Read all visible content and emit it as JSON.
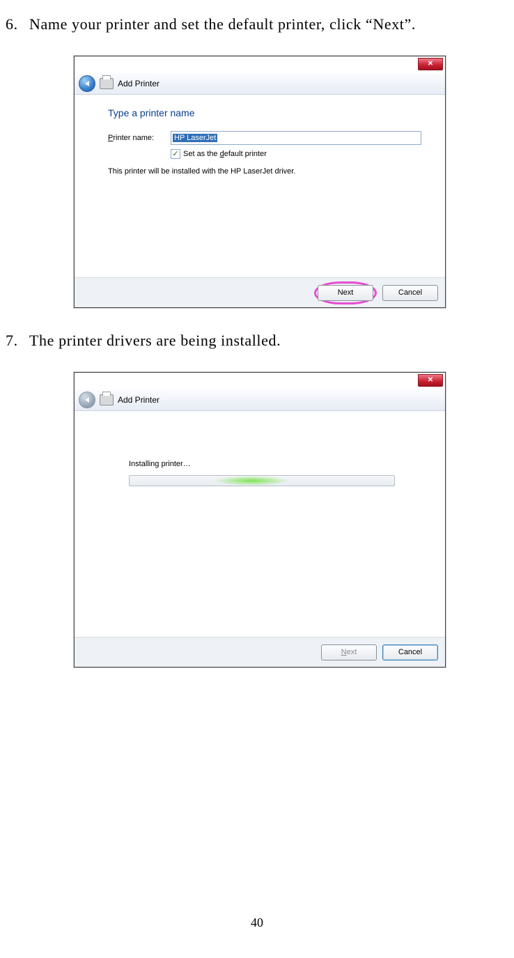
{
  "page_number": "40",
  "steps": {
    "s6": {
      "num": "6.",
      "text": "Name your printer and set the default printer, click “Next”."
    },
    "s7": {
      "num": "7.",
      "text": "The printer drivers are being installed."
    }
  },
  "dialog1": {
    "window_title": "Add Printer",
    "heading": "Type a printer name",
    "pname_label_pre": "P",
    "pname_label_mid": "rinter name:",
    "pname_value": "HP LaserJet",
    "default_pre": "Set as the ",
    "default_u": "d",
    "default_post": "efault printer",
    "driver_info": "This printer will be installed with the HP LaserJet driver.",
    "next": "Next",
    "cancel": "Cancel",
    "close": "✕"
  },
  "dialog2": {
    "window_title": "Add Printer",
    "installing": "Installing printer…",
    "next_pre": "N",
    "next_post": "ext",
    "cancel": "Cancel",
    "close": "✕"
  }
}
